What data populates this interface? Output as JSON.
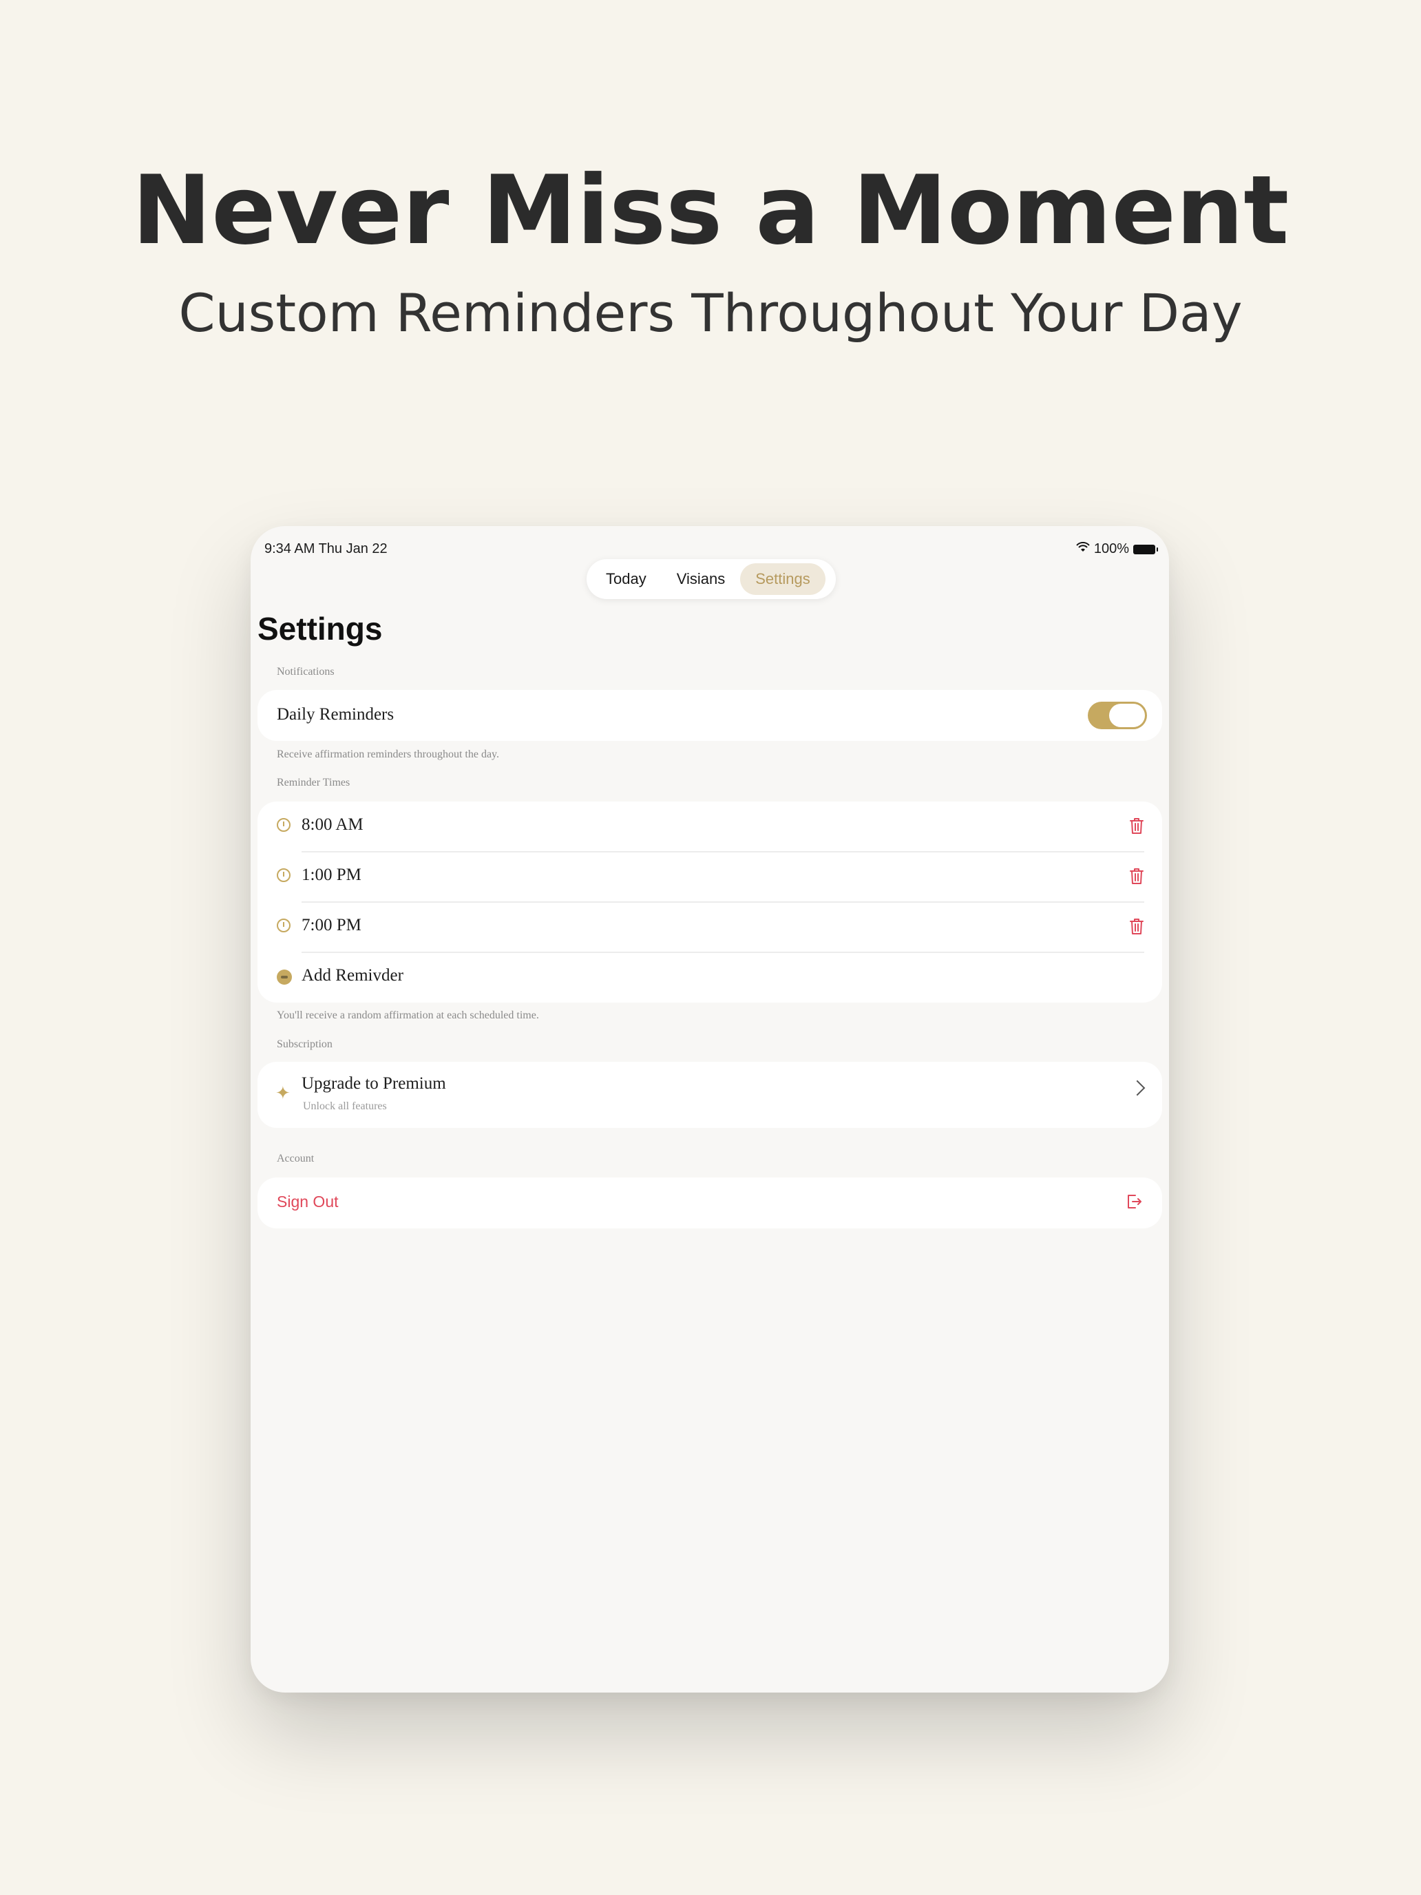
{
  "hero": {
    "title": "Never Miss a Moment",
    "subtitle": "Custom Reminders Throughout Your Day"
  },
  "status_bar": {
    "time": "9:34 AM   Thu Jan 22",
    "battery": "100%",
    "icons": [
      "wifi-icon",
      "battery-icon"
    ]
  },
  "tabs": [
    {
      "label": "Today",
      "active": false
    },
    {
      "label": "Visians",
      "active": false
    },
    {
      "label": "Settings",
      "active": true
    }
  ],
  "page_title": "Settings",
  "notifications": {
    "section_label": "Notifications",
    "daily_reminders_label": "Daily Reminders",
    "daily_reminders_on": true,
    "note": "Receive affirmation reminders throughout the day."
  },
  "reminder_times": {
    "section_label": "Reminder Times",
    "items": [
      "8:00 AM",
      "1:00 PM",
      "7:00 PM"
    ],
    "add_label": "Add Remivder",
    "note": "You'll receive a random affirmation at each scheduled time."
  },
  "subscription": {
    "section_label": "Subscription",
    "title": "Upgrade to Premium",
    "subtitle": "Unlock all features"
  },
  "account": {
    "section_label": "Account",
    "sign_out_label": "Sign Out"
  },
  "colors": {
    "accent": "#c6a960",
    "danger": "#e0485a",
    "background": "#f7f4ec"
  }
}
